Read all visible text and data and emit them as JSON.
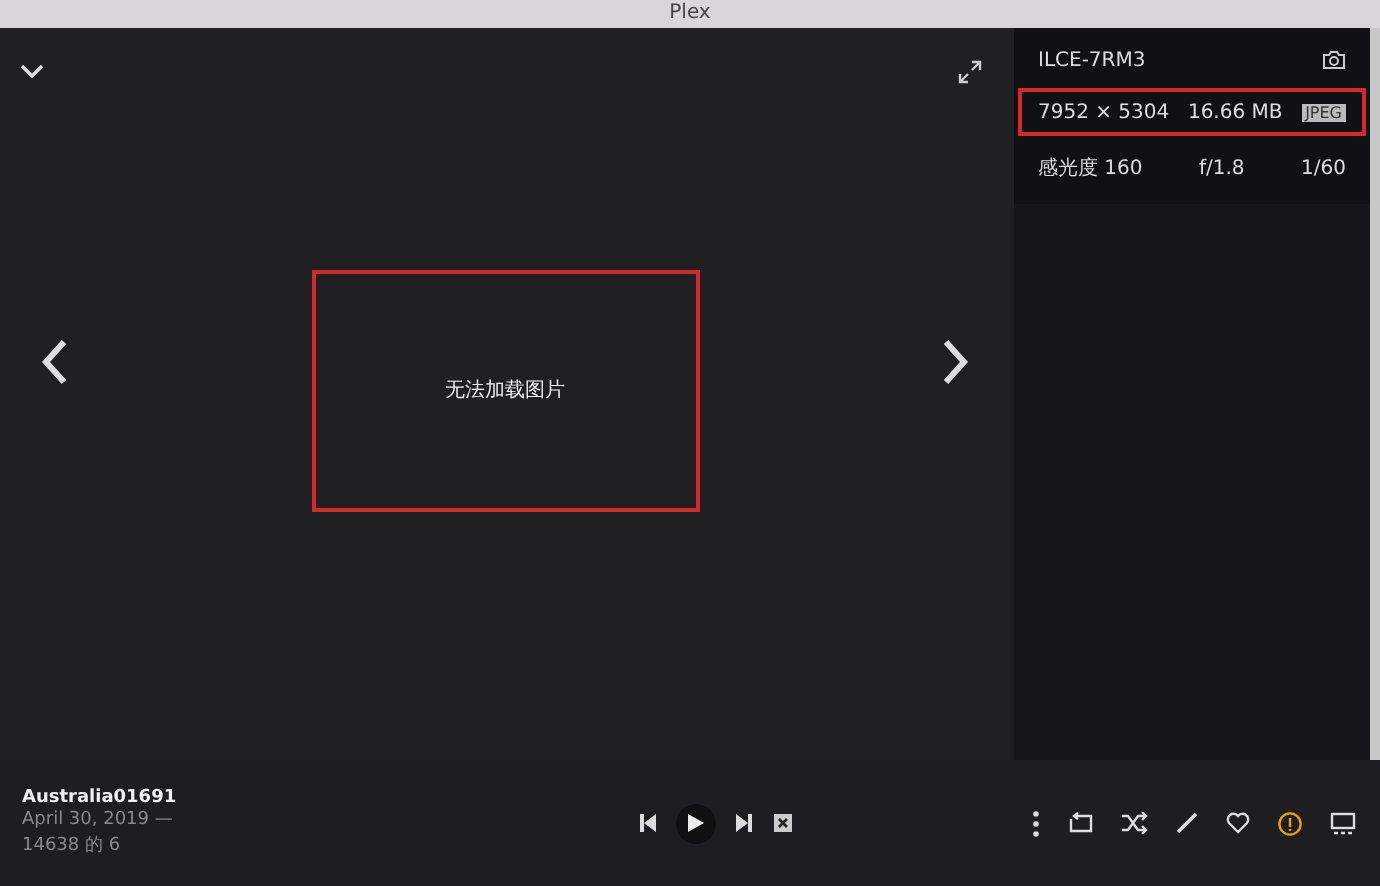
{
  "window": {
    "title": "Plex"
  },
  "viewer": {
    "message": "无法加载图片"
  },
  "info_panel": {
    "camera": "ILCE-7RM3",
    "details": [
      {
        "text": "7952 × 5304"
      },
      {
        "text": "16.66 MB"
      },
      {
        "text": "JPEG",
        "kind": "badge"
      }
    ],
    "exposure": [
      "感光度 160",
      "f/1.8",
      "1/60"
    ]
  },
  "footer": {
    "title": "Australia01691",
    "date": "April 30, 2019 —",
    "position": "14638 的 6",
    "playback": [
      {
        "kind": "previous"
      },
      {
        "kind": "play"
      },
      {
        "kind": "next"
      },
      {
        "kind": "stop"
      }
    ],
    "actions": [
      {
        "kind": "more",
        "active": false
      },
      {
        "kind": "repeat",
        "active": false
      },
      {
        "kind": "shuffle",
        "active": false
      },
      {
        "kind": "edit",
        "active": false
      },
      {
        "kind": "heart",
        "active": false
      },
      {
        "kind": "info",
        "active": true
      },
      {
        "kind": "screen",
        "active": false
      }
    ]
  }
}
